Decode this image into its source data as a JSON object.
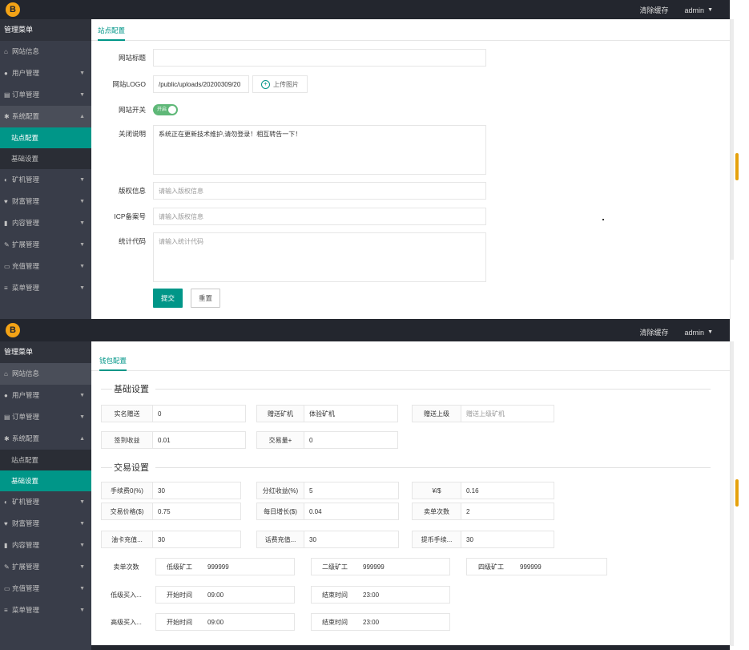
{
  "top": {
    "clear_cache": "清除缓存",
    "user": "admin"
  },
  "logo_letter": "B",
  "sidebar": {
    "header": "管理菜单",
    "items": [
      {
        "icon": "home-icon",
        "glyph": "⌂",
        "label": "网站信息"
      },
      {
        "icon": "users-icon",
        "glyph": "●",
        "label": "用户管理"
      },
      {
        "icon": "order-icon",
        "glyph": "▤",
        "label": "订单管理"
      },
      {
        "icon": "gear-icon",
        "glyph": "✱",
        "label": "系统配置"
      },
      {
        "icon": "",
        "glyph": "",
        "label": "站点配置"
      },
      {
        "icon": "",
        "glyph": "",
        "label": "基础设置"
      },
      {
        "icon": "miner-icon",
        "glyph": "◐",
        "label": "矿机管理"
      },
      {
        "icon": "heart-icon",
        "glyph": "♥",
        "label": "财富管理"
      },
      {
        "icon": "doc-icon",
        "glyph": "▮",
        "label": "内容管理"
      },
      {
        "icon": "wrench-icon",
        "glyph": "✎",
        "label": "扩展管理"
      },
      {
        "icon": "card-icon",
        "glyph": "▭",
        "label": "充值管理"
      },
      {
        "icon": "menu-icon",
        "glyph": "≡",
        "label": "菜单管理"
      }
    ]
  },
  "site_config": {
    "tab": "站点配置",
    "title_label": "网站标题",
    "title_value": "",
    "logo_label": "网站LOGO",
    "logo_value": "/public/uploads/20200309/20",
    "upload_label": "上传图片",
    "switch_label": "网站开关",
    "switch_text": "开启",
    "close_label": "关闭说明",
    "close_value": "系统正在更新技术维护,请勿登录！相互转告一下！",
    "copyright_label": "版权信息",
    "copyright_placeholder": "请输入版权信息",
    "icp_label": "ICP备案号",
    "icp_placeholder": "请输入版权信息",
    "stats_label": "统计代码",
    "stats_placeholder": "请输入统计代码",
    "submit": "提交",
    "reset": "重置"
  },
  "wallet_config": {
    "tab": "钱包配置",
    "basic_title": "基础设置",
    "trade_title": "交易设置",
    "basic": [
      {
        "k": "实名赠送",
        "v": "0"
      },
      {
        "k": "赠送矿机",
        "v": "体验矿机"
      },
      {
        "k": "赠送上级",
        "v": "赠送上级矿机"
      },
      {
        "k": "签到收益",
        "v": "0.01"
      },
      {
        "k": "交易量+",
        "v": "0"
      }
    ],
    "trade": [
      {
        "k": "手续费0(%)",
        "v": "30"
      },
      {
        "k": "分红收益(%)",
        "v": "5"
      },
      {
        "k": "¥/$",
        "v": "0.16"
      },
      {
        "k": "交易价格($)",
        "v": "0.75"
      },
      {
        "k": "每日增长($)",
        "v": "0.04"
      },
      {
        "k": "卖单次数",
        "v": "2"
      },
      {
        "k": "油卡充值...",
        "v": "30"
      },
      {
        "k": "话费充值...",
        "v": "30"
      },
      {
        "k": "提币手续...",
        "v": "30"
      }
    ],
    "sell_label": "卖单次数",
    "sell": [
      {
        "k": "低级矿工",
        "v": "999999"
      },
      {
        "k": "二级矿工",
        "v": "999999"
      },
      {
        "k": "四级矿工",
        "v": "999999"
      }
    ],
    "low_buy": {
      "label": "低级买入...",
      "start_k": "开始时间",
      "start_v": "09:00",
      "end_k": "结束时间",
      "end_v": "23:00"
    },
    "high_buy": {
      "label": "高级买入...",
      "start_k": "开始时间",
      "start_v": "09:00",
      "end_k": "结束时间",
      "end_v": "23:00"
    }
  }
}
